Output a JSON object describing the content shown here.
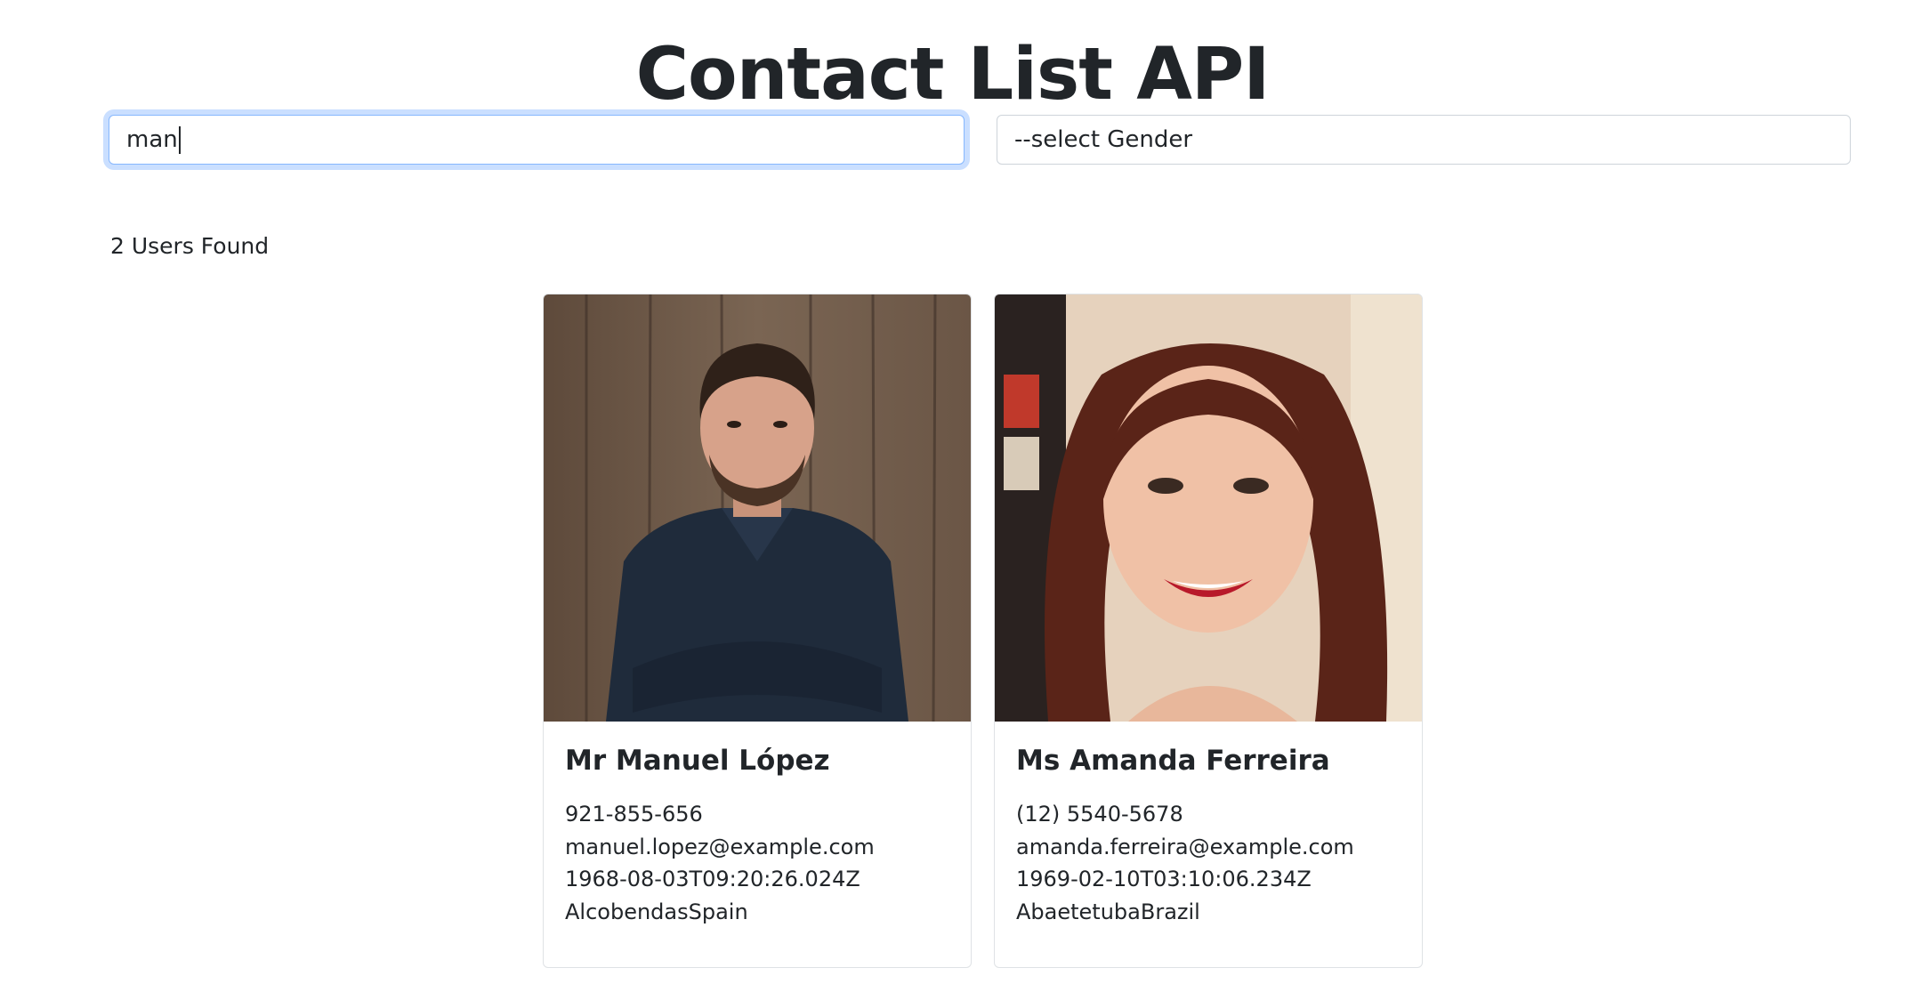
{
  "header": {
    "title": "Contact List API"
  },
  "search": {
    "value": "man"
  },
  "gender_select": {
    "selected": "--select Gender"
  },
  "results": {
    "count_text": "2 Users Found"
  },
  "users": [
    {
      "name": "Mr Manuel López",
      "phone": "921-855-656",
      "email": "manuel.lopez@example.com",
      "dob": "1968-08-03T09:20:26.024Z",
      "location": "AlcobendasSpain"
    },
    {
      "name": "Ms Amanda Ferreira",
      "phone": "(12) 5540-5678",
      "email": "amanda.ferreira@example.com",
      "dob": "1969-02-10T03:10:06.234Z",
      "location": "AbaetetubaBrazil"
    }
  ],
  "colors": {
    "focus_ring": "#86b7fe",
    "border": "#ced4da",
    "text": "#212529"
  }
}
